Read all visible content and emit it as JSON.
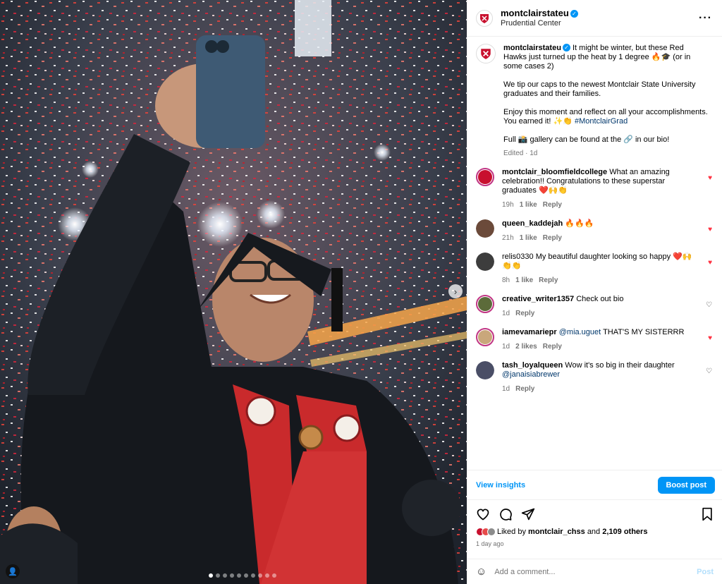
{
  "post": {
    "username": "montclairstateu",
    "location": "Prudential Center",
    "more_icon": "more-horizontal-icon"
  },
  "caption": {
    "line1": "It might be winter, but these Red Hawks just turned up the heat by 1 degree 🔥🎓 (or in some cases 2)",
    "line2": "We tip our caps to the newest Montclair State University graduates and their families.",
    "line3a": "Enjoy this moment and reflect on all your accomplishments. You earned it! ✨👏",
    "line3_tag": "#MontclairGrad",
    "line4": "Full 📸 gallery can be found at the 🔗 in our bio!",
    "meta": "Edited · 1d"
  },
  "comments": [
    {
      "user": "montclair_bloomfieldcollege",
      "text": "What an amazing celebration!! Congratulations to these superstar graduates ❤️🙌👏",
      "time": "19h",
      "likes": "1 like",
      "reply": "Reply",
      "liked": true,
      "avatar_color": "#c8102e"
    },
    {
      "user": "queen_kaddejah",
      "text": "🔥🔥🔥",
      "time": "21h",
      "likes": "1 like",
      "reply": "Reply",
      "liked": true,
      "avatar_color": "#6b4a3a"
    },
    {
      "user": "relis0330",
      "text": "My beautiful daughter looking so happy ❤️🙌👏👏",
      "time": "8h",
      "likes": "1 like",
      "reply": "Reply",
      "liked": true,
      "avatar_color": "#3d3d3d"
    },
    {
      "user": "creative_writer1357",
      "text": "Check out bio",
      "time": "1d",
      "likes": "",
      "reply": "Reply",
      "liked": false,
      "avatar_color": "#5c6b3a"
    },
    {
      "user": "iamevamariepr",
      "mention": "@mia.uguet",
      "text": "THAT'S MY SISTERRR",
      "time": "1d",
      "likes": "2 likes",
      "reply": "Reply",
      "liked": true,
      "avatar_color": "#c9a77b"
    },
    {
      "user": "tash_loyalqueen",
      "text": "Wow it's so big in their daughter",
      "mention2": "@janaisiabrewer",
      "time": "1d",
      "likes": "",
      "reply": "Reply",
      "liked": false,
      "avatar_color": "#4a4e66"
    }
  ],
  "insights": {
    "view": "View insights",
    "boost": "Boost post"
  },
  "likes": {
    "prefix": "Liked by",
    "user": "montclair_chss",
    "mid": "and",
    "count": "2,109 others",
    "time": "1 day ago"
  },
  "add_comment": {
    "placeholder": "Add a comment...",
    "post": "Post"
  },
  "colors": {
    "accent": "#0095f6",
    "heart": "#ff3040",
    "brand": "#c8102e"
  }
}
